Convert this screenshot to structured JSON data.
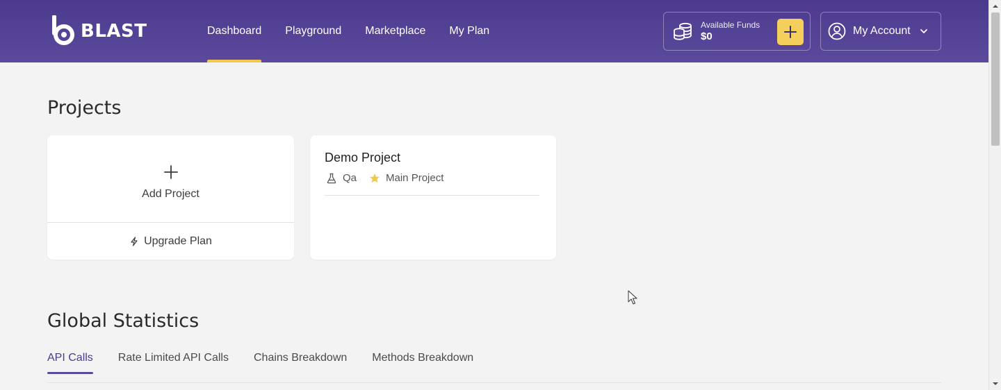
{
  "header": {
    "logo_text": "BLAST",
    "nav": [
      {
        "label": "Dashboard",
        "active": true
      },
      {
        "label": "Playground",
        "active": false
      },
      {
        "label": "Marketplace",
        "active": false
      },
      {
        "label": "My Plan",
        "active": false
      }
    ],
    "funds": {
      "label": "Available Funds",
      "value": "$0"
    },
    "account": {
      "label": "My Account"
    }
  },
  "projects": {
    "title": "Projects",
    "add_card": {
      "label": "Add Project",
      "upgrade_label": "Upgrade Plan"
    },
    "demo_card": {
      "name": "Demo Project",
      "environment": "Qa",
      "tag": "Main Project"
    }
  },
  "stats": {
    "title": "Global Statistics",
    "tabs": [
      {
        "label": "API Calls",
        "active": true
      },
      {
        "label": "Rate Limited API Calls",
        "active": false
      },
      {
        "label": "Chains Breakdown",
        "active": false
      },
      {
        "label": "Methods Breakdown",
        "active": false
      }
    ]
  },
  "colors": {
    "header_bg": "#4c3a8e",
    "accent_yellow": "#f2c94c",
    "active_tab": "#4c3a8e"
  }
}
